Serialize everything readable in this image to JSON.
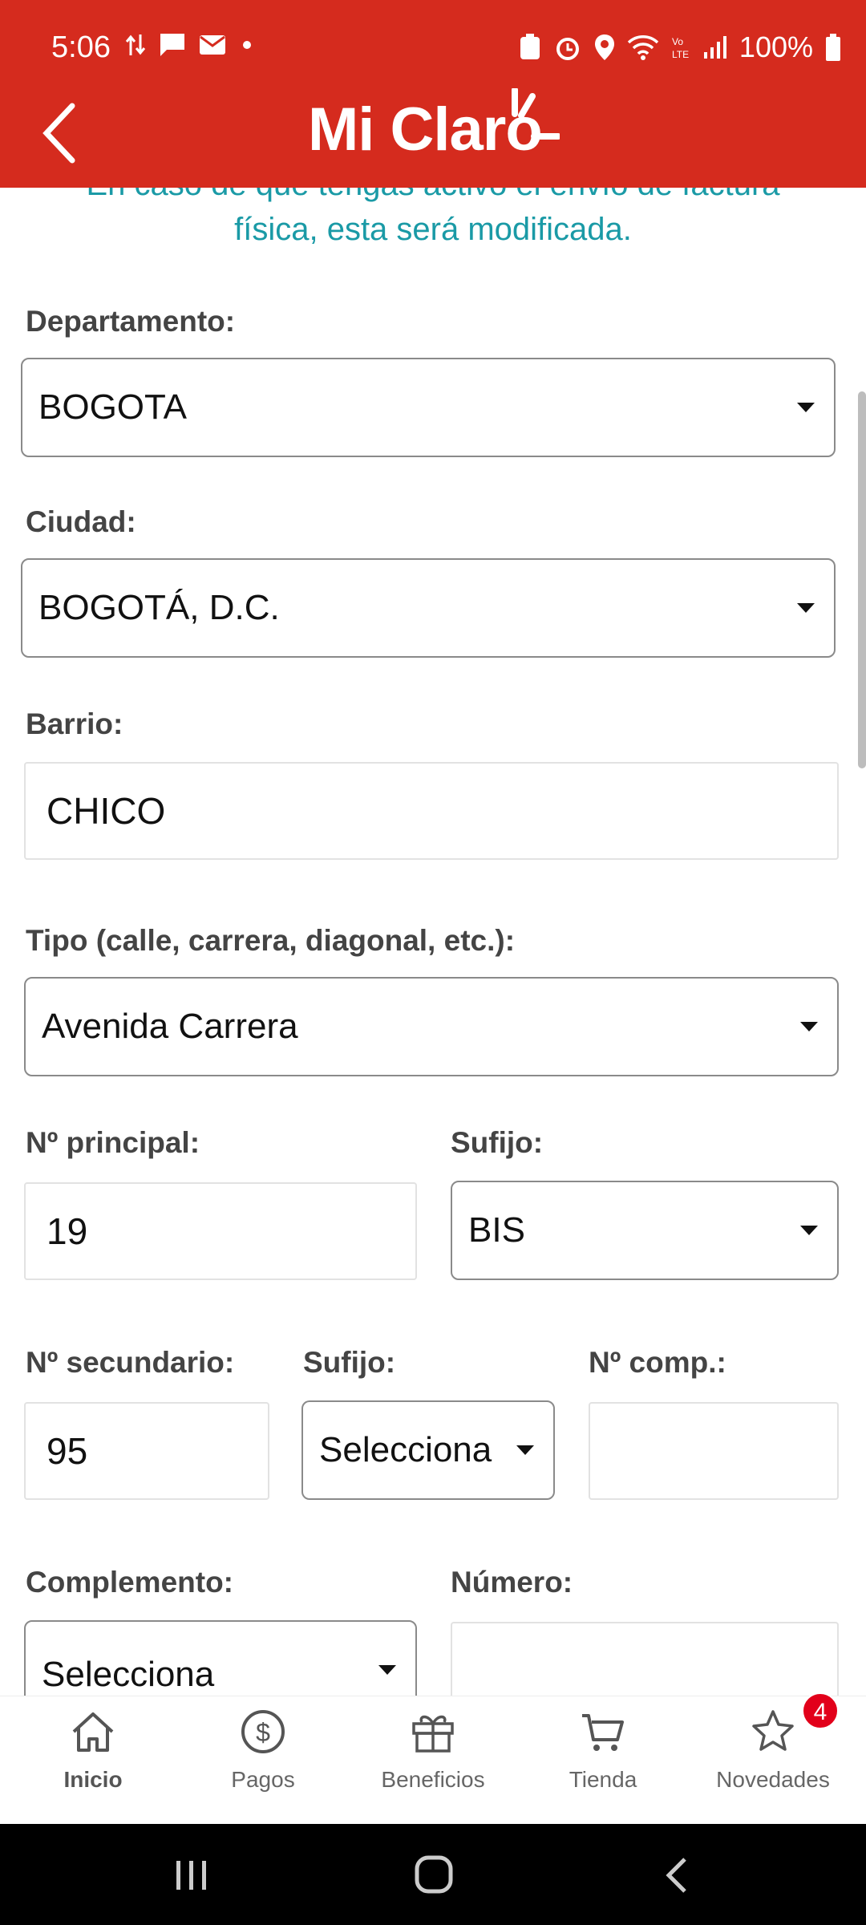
{
  "status_bar": {
    "time": "5:06",
    "battery": "100%"
  },
  "header": {
    "app_name": "Mi Claro"
  },
  "notice": {
    "line1": "En caso de que tengas activo el envío de factura",
    "line2": "física, esta será modificada."
  },
  "form": {
    "departamento": {
      "label": "Departamento:",
      "value": "BOGOTA"
    },
    "ciudad": {
      "label": "Ciudad:",
      "value": "BOGOTÁ, D.C."
    },
    "barrio": {
      "label": "Barrio:",
      "value": "CHICO"
    },
    "tipo": {
      "label": "Tipo (calle, carrera, diagonal, etc.):",
      "value": "Avenida Carrera"
    },
    "no_principal": {
      "label": "Nº principal:",
      "value": "19"
    },
    "sufijo1": {
      "label": "Sufijo:",
      "value": "BIS"
    },
    "no_secundario": {
      "label": "Nº secundario:",
      "value": "95"
    },
    "sufijo2": {
      "label": "Sufijo:",
      "value": "Selecciona"
    },
    "no_comp": {
      "label": "Nº comp.:",
      "value": ""
    },
    "complemento": {
      "label": "Complemento:",
      "value": "Selecciona"
    },
    "numero": {
      "label": "Número:",
      "value": ""
    }
  },
  "bottom_nav": {
    "items": [
      {
        "label": "Inicio",
        "icon": "home-icon"
      },
      {
        "label": "Pagos",
        "icon": "dollar-icon"
      },
      {
        "label": "Beneficios",
        "icon": "gift-icon"
      },
      {
        "label": "Tienda",
        "icon": "cart-icon"
      },
      {
        "label": "Novedades",
        "icon": "star-icon"
      }
    ],
    "badge_count": "4"
  },
  "colors": {
    "brand": "#d52b1e",
    "notice_text": "#1a9aa6",
    "badge": "#e2001a"
  }
}
